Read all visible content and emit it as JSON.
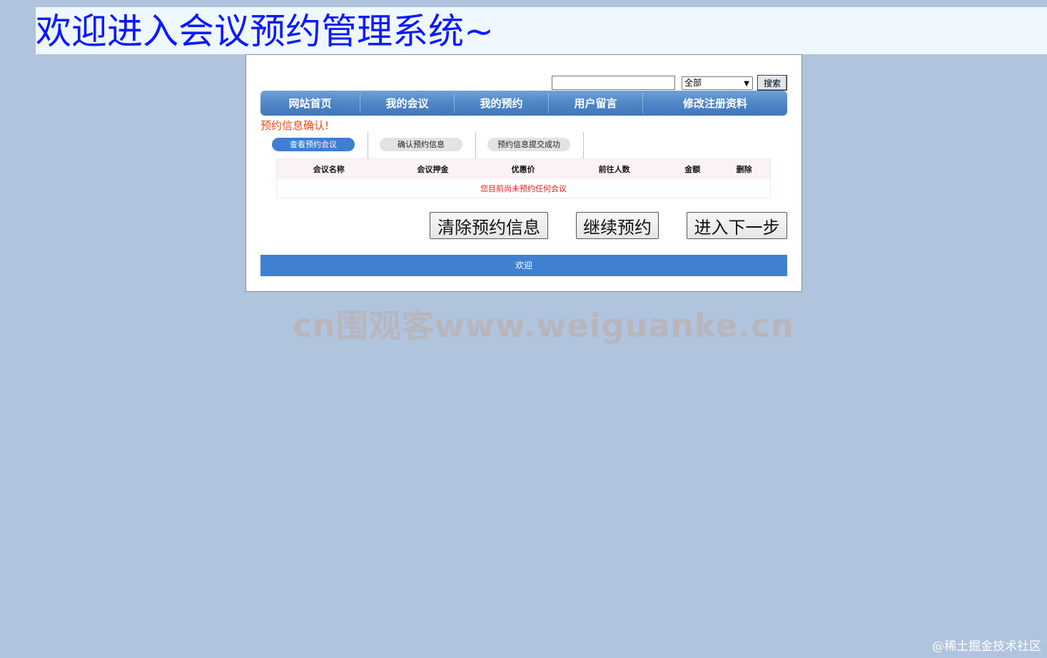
{
  "header": {
    "title": "欢迎进入会议预约管理系统~"
  },
  "search": {
    "value": "",
    "placeholder": "",
    "scope_selected": "全部",
    "button_label": "搜索"
  },
  "nav": {
    "items": [
      {
        "label": "网站首页"
      },
      {
        "label": "我的会议"
      },
      {
        "label": "我的预约"
      },
      {
        "label": "用户留言"
      },
      {
        "label": "修改注册资料"
      }
    ]
  },
  "confirm": {
    "title": "预约信息确认!"
  },
  "steps": [
    {
      "label": "查看预约会议",
      "active": true
    },
    {
      "label": "确认预约信息",
      "active": false
    },
    {
      "label": "预约信息提交成功",
      "active": false
    }
  ],
  "table": {
    "headers": [
      "会议名称",
      "会议押金",
      "优惠价",
      "前往人数",
      "金额",
      "删除"
    ],
    "empty_message": "您目前尚未预约任何会议"
  },
  "actions": {
    "clear_label": "清除预约信息",
    "continue_label": "继续预约",
    "next_label": "进入下一步"
  },
  "footer": {
    "text": "欢迎"
  },
  "watermarks": {
    "center": "cn围观客www.weiguanke.cn",
    "corner": "@稀土掘金技术社区"
  },
  "colors": {
    "page_background": "#b0c4de",
    "title_color": "#0a1aff",
    "nav_blue": "#4c84c6",
    "confirm_orange": "#e2501b",
    "empty_red": "#e11b1b",
    "footer_blue": "#3f80d1"
  }
}
